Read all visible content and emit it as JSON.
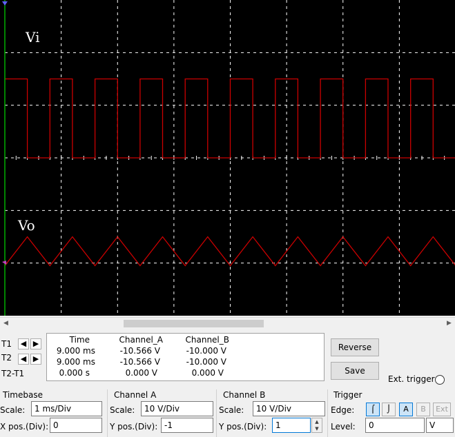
{
  "scope": {
    "trace_labels": {
      "top": "Vi",
      "bottom": "Vo"
    },
    "colors": {
      "background": "#000000",
      "trace": "#cc0000",
      "grid": "#ffffff",
      "cursor": "#00b000"
    },
    "divisions": {
      "horizontal": 8,
      "vertical": 6
    },
    "vi_wave": {
      "type": "square",
      "high_div": 2.0,
      "low_div": 0.0,
      "periods_on_screen": 10,
      "duty": 0.5
    },
    "vo_wave": {
      "type": "triangle",
      "peak_div": 0.5,
      "trough_div": -0.05,
      "periods_on_screen": 10
    }
  },
  "cursors": {
    "t1_label": "T1",
    "t2_label": "T2",
    "diff_label": "T2-T1",
    "left_arrow": "◀",
    "right_arrow": "▶"
  },
  "readout": {
    "headers": [
      "Time",
      "Channel_A",
      "Channel_B"
    ],
    "rows": [
      [
        "9.000 ms",
        "-10.566 V",
        "-10.000 V"
      ],
      [
        "9.000 ms",
        "-10.566 V",
        "-10.000 V"
      ],
      [
        "0.000 s",
        "0.000 V",
        "0.000 V"
      ]
    ]
  },
  "buttons": {
    "reverse": "Reverse",
    "save": "Save"
  },
  "ext_trigger": {
    "label": "Ext. trigger"
  },
  "timebase": {
    "title": "Timebase",
    "scale_label": "Scale:",
    "scale_value": "1 ms/Div",
    "xpos_label": "X pos.(Div):",
    "xpos_value": "0"
  },
  "channel_a": {
    "title": "Channel A",
    "scale_label": "Scale:",
    "scale_value": "10  V/Div",
    "ypos_label": "Y pos.(Div):",
    "ypos_value": "-1"
  },
  "channel_b": {
    "title": "Channel B",
    "scale_label": "Scale:",
    "scale_value": "10  V/Div",
    "ypos_label": "Y pos.(Div):",
    "ypos_value": "1"
  },
  "trigger": {
    "title": "Trigger",
    "edge_label": "Edge:",
    "edge_buttons": [
      "⌠",
      "⌡",
      "A",
      "B",
      "Ext"
    ],
    "level_label": "Level:",
    "level_value": "0",
    "level_unit": "V"
  }
}
